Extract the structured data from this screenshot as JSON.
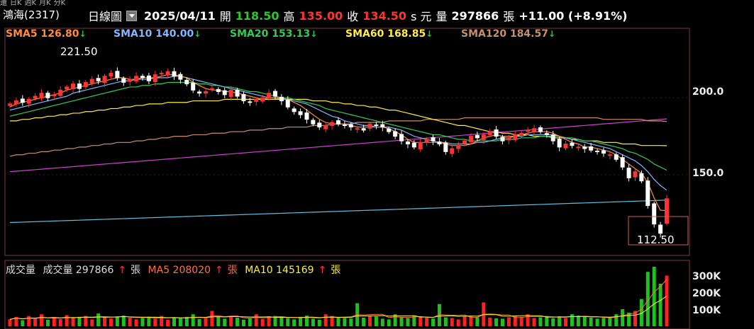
{
  "tabs": [
    "還",
    "日K",
    "週K",
    "月K",
    "分K"
  ],
  "stock_title": "鴻海(2317)",
  "header": {
    "period": "日線圖",
    "date": "2025/04/11",
    "open_label": "開",
    "open": "118.50",
    "high_label": "高",
    "high": "135.00",
    "close_label": "收",
    "close": "134.50",
    "unit": "s 元",
    "vol_label": "量",
    "volume": "297866",
    "vol_unit": "張",
    "change": "+11.00 (+8.91%)"
  },
  "ma_legend": [
    {
      "label": "SMA5 126.80",
      "color": "#ff8c3a",
      "arrow": "↓"
    },
    {
      "label": "SMA10 140.00",
      "color": "#80b8ff",
      "arrow": "↓"
    },
    {
      "label": "SMA20 153.13",
      "color": "#33cc55",
      "arrow": "↓"
    },
    {
      "label": "SMA60 168.85",
      "color": "#ffee44",
      "arrow": "↓"
    },
    {
      "label": "SMA120 184.57",
      "color": "#c8906a",
      "arrow": "↓"
    }
  ],
  "annotations": {
    "high_value": "221.50",
    "low_value": "112.50"
  },
  "volume_legend": {
    "title": "成交量",
    "vol_text": "成交量 297866",
    "vol_unit": "張",
    "ma5_text": "MA5 208020",
    "ma5_unit": "張",
    "ma10_text": "MA10 145169",
    "ma10_unit": "張"
  },
  "chart_data": {
    "type": "candlestick",
    "y_ticks": [
      "200.0",
      "150.0"
    ],
    "volume_ticks": [
      "300K",
      "200K",
      "100K"
    ],
    "ylim": [
      105,
      235
    ],
    "candles_close": [
      196,
      198,
      197,
      199,
      201,
      203,
      200,
      202,
      205,
      207,
      209,
      206,
      210,
      212,
      211,
      214,
      216,
      213,
      210,
      212,
      214,
      213,
      211,
      215,
      216,
      217,
      214,
      212,
      209,
      205,
      203,
      204,
      206,
      204,
      202,
      205,
      201,
      198,
      197,
      199,
      200,
      203,
      201,
      198,
      194,
      191,
      189,
      186,
      183,
      181,
      182,
      184,
      183,
      182,
      181,
      180,
      179,
      183,
      182,
      181,
      178,
      175,
      172,
      170,
      168,
      171,
      173,
      172,
      170,
      165,
      167,
      169,
      172,
      175,
      174,
      176,
      178,
      175,
      172,
      174,
      176,
      177,
      179,
      180,
      178,
      176,
      172,
      168,
      170,
      169,
      168,
      167,
      166,
      165,
      164,
      163,
      160,
      155,
      148,
      152,
      146,
      130,
      118,
      112,
      134.5
    ],
    "sma5": [
      194,
      196,
      197,
      198,
      199,
      200,
      201,
      202,
      203,
      205,
      206,
      207,
      208,
      209,
      210,
      211,
      212,
      213,
      213,
      212,
      212,
      213,
      213,
      213,
      214,
      215,
      215,
      214,
      213,
      210,
      208,
      206,
      205,
      205,
      204,
      204,
      203,
      202,
      201,
      200,
      199,
      200,
      200,
      200,
      199,
      197,
      195,
      192,
      189,
      186,
      184,
      183,
      183,
      183,
      182,
      181,
      181,
      181,
      181,
      181,
      180,
      178,
      176,
      173,
      171,
      171,
      171,
      171,
      171,
      170,
      169,
      169,
      169,
      170,
      172,
      174,
      175,
      176,
      175,
      175,
      175,
      176,
      177,
      178,
      178,
      178,
      177,
      175,
      173,
      171,
      170,
      168,
      168,
      167,
      166,
      165,
      163,
      160,
      157,
      154,
      151,
      145,
      135,
      127,
      126.8
    ],
    "sma10": [
      192,
      193,
      194,
      195,
      196,
      197,
      198,
      199,
      200,
      201,
      203,
      204,
      205,
      206,
      207,
      208,
      209,
      210,
      211,
      211,
      212,
      212,
      212,
      213,
      213,
      213,
      214,
      214,
      213,
      212,
      211,
      210,
      209,
      208,
      207,
      206,
      205,
      204,
      203,
      202,
      201,
      200,
      200,
      199,
      199,
      198,
      197,
      196,
      194,
      192,
      190,
      188,
      187,
      185,
      184,
      183,
      182,
      182,
      181,
      181,
      181,
      180,
      179,
      177,
      175,
      174,
      173,
      172,
      171,
      171,
      170,
      170,
      170,
      170,
      171,
      171,
      172,
      173,
      174,
      174,
      175,
      175,
      176,
      176,
      176,
      176,
      176,
      175,
      174,
      173,
      172,
      171,
      170,
      169,
      168,
      167,
      165,
      163,
      161,
      159,
      156,
      152,
      147,
      143,
      140
    ],
    "sma20": [
      188,
      189,
      190,
      191,
      192,
      193,
      194,
      195,
      196,
      197,
      198,
      199,
      200,
      201,
      202,
      203,
      204,
      205,
      206,
      207,
      207,
      208,
      208,
      209,
      209,
      210,
      210,
      210,
      210,
      210,
      209,
      209,
      208,
      208,
      207,
      207,
      206,
      205,
      204,
      204,
      203,
      202,
      201,
      200,
      200,
      199,
      198,
      197,
      196,
      195,
      193,
      192,
      191,
      190,
      189,
      188,
      187,
      186,
      185,
      184,
      183,
      182,
      181,
      180,
      179,
      178,
      177,
      176,
      176,
      175,
      174,
      173,
      173,
      172,
      172,
      172,
      172,
      172,
      173,
      173,
      173,
      174,
      174,
      174,
      175,
      175,
      175,
      175,
      174,
      174,
      173,
      172,
      172,
      171,
      170,
      169,
      168,
      167,
      165,
      164,
      162,
      160,
      157,
      155,
      153
    ],
    "sma60": [
      185,
      185,
      186,
      186,
      187,
      187,
      188,
      188,
      189,
      189,
      190,
      190,
      191,
      191,
      192,
      192,
      193,
      193,
      194,
      194,
      195,
      195,
      196,
      196,
      196,
      197,
      197,
      197,
      197,
      198,
      198,
      198,
      198,
      198,
      199,
      199,
      199,
      199,
      199,
      199,
      199,
      199,
      199,
      199,
      199,
      199,
      199,
      199,
      198,
      198,
      198,
      197,
      197,
      196,
      196,
      195,
      195,
      194,
      194,
      193,
      192,
      192,
      191,
      190,
      189,
      188,
      187,
      186,
      185,
      184,
      183,
      182,
      182,
      181,
      180,
      179,
      178,
      178,
      177,
      177,
      176,
      176,
      176,
      175,
      175,
      175,
      174,
      174,
      174,
      173,
      173,
      172,
      172,
      172,
      171,
      171,
      171,
      170,
      170,
      170,
      169,
      169,
      169,
      169,
      168.85
    ],
    "sma120": [
      162,
      163,
      163,
      164,
      164,
      165,
      165,
      166,
      166,
      167,
      167,
      168,
      168,
      169,
      169,
      170,
      170,
      171,
      171,
      171,
      172,
      172,
      173,
      173,
      174,
      174,
      175,
      175,
      175,
      176,
      176,
      176,
      177,
      177,
      177,
      178,
      178,
      178,
      179,
      179,
      179,
      180,
      180,
      180,
      181,
      181,
      181,
      181,
      182,
      182,
      182,
      183,
      183,
      183,
      183,
      184,
      184,
      184,
      184,
      184,
      185,
      185,
      185,
      185,
      185,
      185,
      186,
      186,
      186,
      186,
      186,
      186,
      187,
      187,
      187,
      187,
      187,
      187,
      187,
      187,
      187,
      187,
      187,
      187,
      187,
      187,
      187,
      187,
      187,
      187,
      187,
      187,
      187,
      187,
      186,
      186,
      186,
      186,
      186,
      186,
      186,
      185,
      185,
      185,
      184.57
    ],
    "volume": [
      40,
      55,
      35,
      60,
      45,
      70,
      38,
      50,
      42,
      65,
      48,
      55,
      60,
      40,
      75,
      52,
      45,
      58,
      62,
      50,
      40,
      48,
      56,
      44,
      60,
      38,
      52,
      46,
      55,
      70,
      42,
      48,
      90,
      55,
      44,
      60,
      50,
      38,
      45,
      70,
      42,
      58,
      60,
      52,
      48,
      40,
      55,
      62,
      44,
      38,
      70,
      60,
      52,
      48,
      45,
      135,
      50,
      62,
      58,
      44,
      40,
      70,
      52,
      48,
      60,
      55,
      50,
      45,
      130,
      52,
      48,
      40,
      60,
      58,
      52,
      140,
      50,
      46,
      44,
      52,
      60,
      55,
      70,
      48,
      52,
      60,
      46,
      58,
      48,
      70,
      62,
      55,
      50,
      44,
      48,
      52,
      70,
      100,
      80,
      90,
      160,
      320,
      350,
      250,
      297.9
    ]
  }
}
